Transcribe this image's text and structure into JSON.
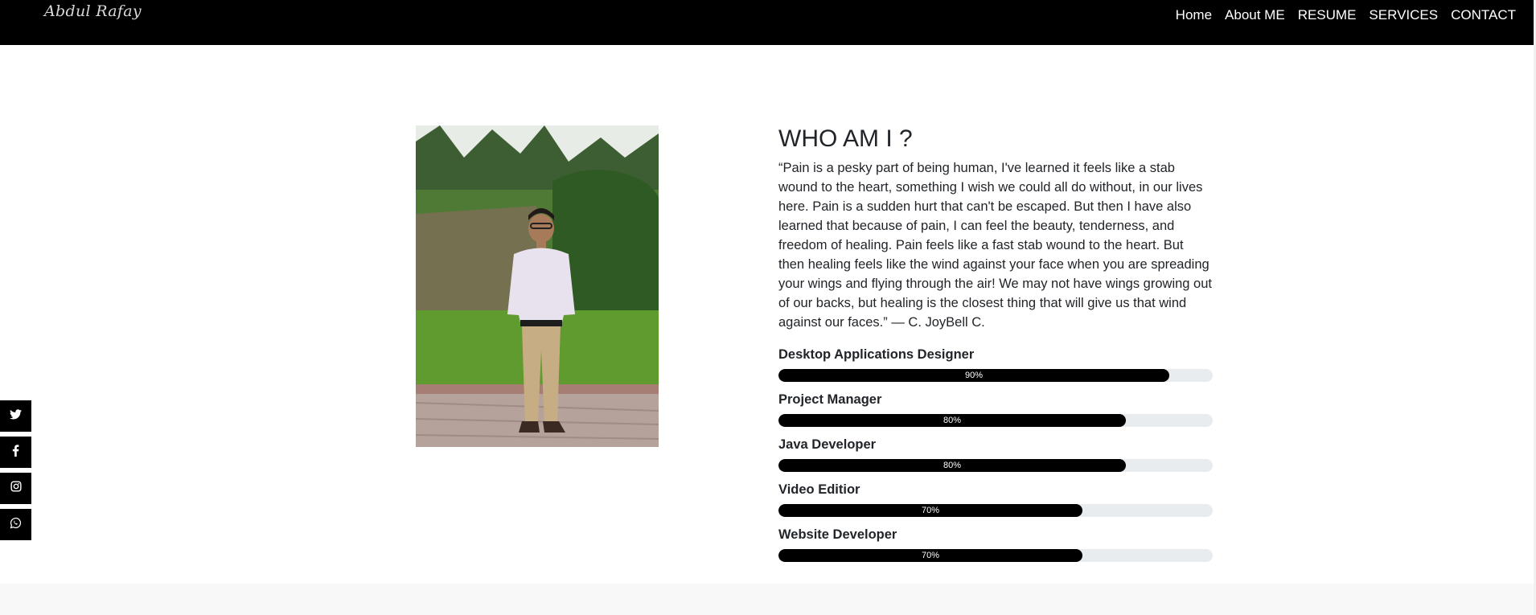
{
  "brand": {
    "name": "Abdul Rafay"
  },
  "nav": [
    {
      "label": "Home"
    },
    {
      "label": "About ME"
    },
    {
      "label": "RESUME"
    },
    {
      "label": "SERVICES"
    },
    {
      "label": "CONTACT"
    }
  ],
  "about": {
    "title": "WHO AM I ?",
    "quote": "“Pain is a pesky part of being human, I've learned it feels like a stab wound to the heart, something I wish we could all do without, in our lives here. Pain is a sudden hurt that can't be escaped. But then I have also learned that because of pain, I can feel the beauty, tenderness, and freedom of healing. Pain feels like a fast stab wound to the heart. But then healing feels like the wind against your face when you are spreading your wings and flying through the air! We may not have wings growing out of our backs, but healing is the closest thing that will give us that wind against our faces.” ― C. JoyBell C."
  },
  "skills": [
    {
      "name": "Desktop Applications Designer",
      "percent": 90,
      "label": "90%"
    },
    {
      "name": "Project Manager",
      "percent": 80,
      "label": "80%"
    },
    {
      "name": "Java Developer",
      "percent": 80,
      "label": "80%"
    },
    {
      "name": "Video Editior",
      "percent": 70,
      "label": "70%"
    },
    {
      "name": "Website Developer",
      "percent": 70,
      "label": "70%"
    }
  ],
  "social": [
    {
      "icon": "twitter-icon"
    },
    {
      "icon": "facebook-icon"
    },
    {
      "icon": "instagram-icon"
    },
    {
      "icon": "whatsapp-icon"
    }
  ],
  "colors": {
    "navbar": "#000000",
    "progress_fill": "#000000",
    "progress_track": "#e9ecef",
    "footer": "#f8f8f8"
  }
}
